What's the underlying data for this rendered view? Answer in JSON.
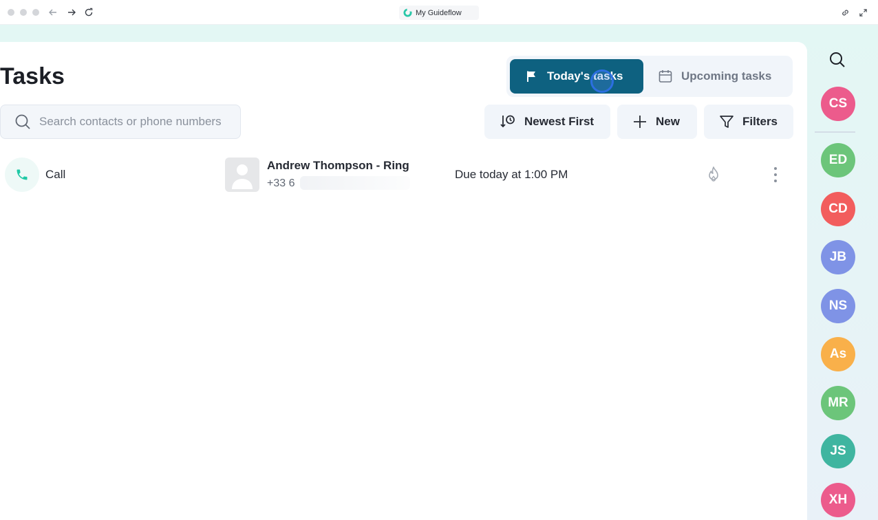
{
  "browser": {
    "tab_title": "My Guideflow"
  },
  "page": {
    "title": "Tasks"
  },
  "view_tabs": [
    {
      "label": "Today's tasks",
      "icon": "flag-icon",
      "active": true
    },
    {
      "label": "Upcoming tasks",
      "icon": "calendar-icon",
      "active": false
    }
  ],
  "search": {
    "placeholder": "Search contacts or phone numbers",
    "value": ""
  },
  "toolbar": {
    "sort_label": "Newest First",
    "new_label": "New",
    "filters_label": "Filters"
  },
  "tasks": [
    {
      "type": "Call",
      "contact_name": "Andrew Thompson - Ring",
      "phone_visible": "+33 6",
      "due": "Due today at 1:00 PM"
    }
  ],
  "sidebar": {
    "avatars": [
      {
        "initials": "CS",
        "color": "#ec5b8c"
      },
      {
        "initials": "ED",
        "color": "#6cc57a"
      },
      {
        "initials": "CD",
        "color": "#f25d5d"
      },
      {
        "initials": "JB",
        "color": "#7f93e6"
      },
      {
        "initials": "NS",
        "color": "#7f93e6"
      },
      {
        "initials": "As",
        "color": "#f9b04a"
      },
      {
        "initials": "MR",
        "color": "#6cc57a"
      },
      {
        "initials": "JS",
        "color": "#3fb5a0"
      },
      {
        "initials": "XH",
        "color": "#ec5b8c"
      }
    ]
  },
  "colors": {
    "accent": "#0e6180",
    "call_green": "#20c9a6"
  }
}
